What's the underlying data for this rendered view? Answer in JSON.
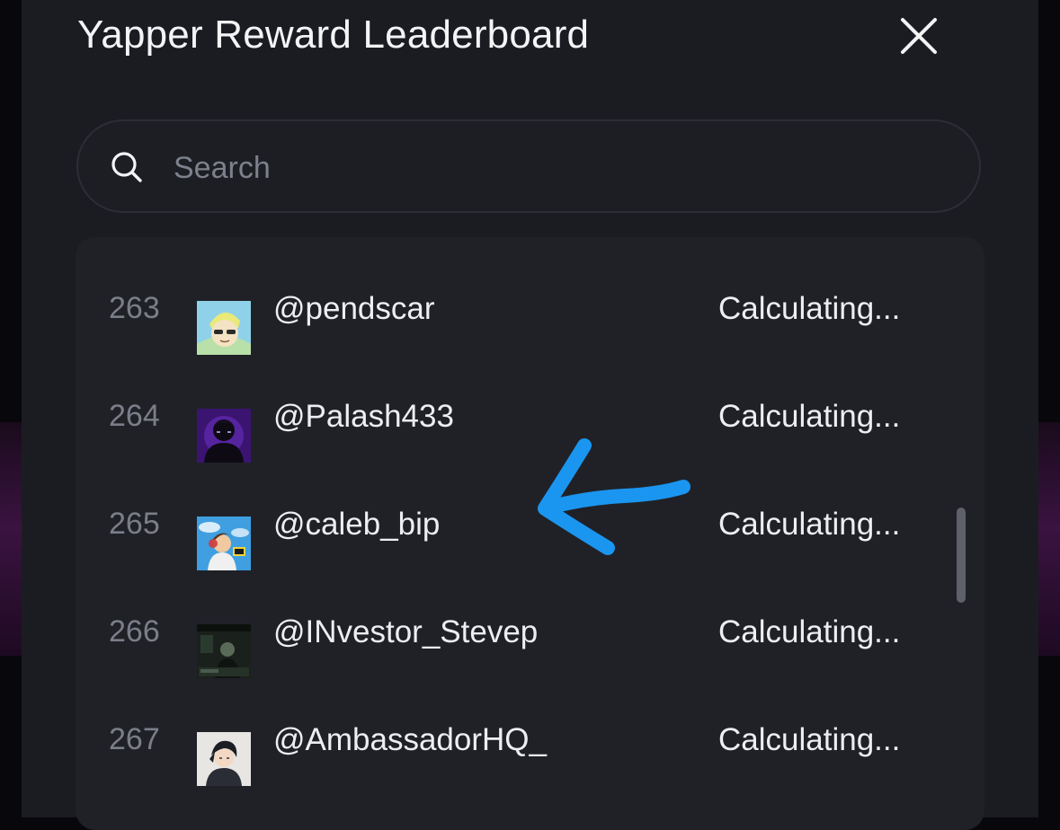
{
  "modal": {
    "title": "Yapper Reward Leaderboard"
  },
  "search": {
    "placeholder": "Search",
    "value": ""
  },
  "leaderboard": {
    "rows": [
      {
        "rank": "263",
        "handle": "@pendscar",
        "reward": "Calculating..."
      },
      {
        "rank": "264",
        "handle": "@Palash433",
        "reward": "Calculating..."
      },
      {
        "rank": "265",
        "handle": "@caleb_bip",
        "reward": "Calculating..."
      },
      {
        "rank": "266",
        "handle": "@INvestor_Stevep",
        "reward": "Calculating..."
      },
      {
        "rank": "267",
        "handle": "@AmbassadorHQ_",
        "reward": "Calculating..."
      }
    ]
  },
  "colors": {
    "background": "#08070b",
    "modal": "#1b1c22",
    "list_panel": "#202127",
    "annotation_arrow": "#1a96f0"
  },
  "icons": [
    "close-icon",
    "search-icon"
  ]
}
